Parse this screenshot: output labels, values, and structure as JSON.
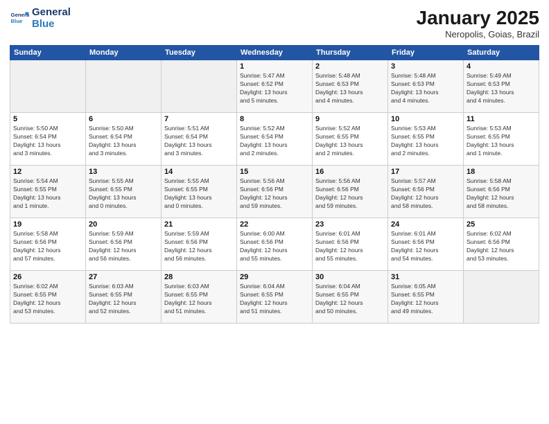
{
  "header": {
    "logo_line1": "General",
    "logo_line2": "Blue",
    "month": "January 2025",
    "location": "Neropolis, Goias, Brazil"
  },
  "weekdays": [
    "Sunday",
    "Monday",
    "Tuesday",
    "Wednesday",
    "Thursday",
    "Friday",
    "Saturday"
  ],
  "weeks": [
    [
      {
        "day": "",
        "info": ""
      },
      {
        "day": "",
        "info": ""
      },
      {
        "day": "",
        "info": ""
      },
      {
        "day": "1",
        "info": "Sunrise: 5:47 AM\nSunset: 6:52 PM\nDaylight: 13 hours\nand 5 minutes."
      },
      {
        "day": "2",
        "info": "Sunrise: 5:48 AM\nSunset: 6:53 PM\nDaylight: 13 hours\nand 4 minutes."
      },
      {
        "day": "3",
        "info": "Sunrise: 5:48 AM\nSunset: 6:53 PM\nDaylight: 13 hours\nand 4 minutes."
      },
      {
        "day": "4",
        "info": "Sunrise: 5:49 AM\nSunset: 6:53 PM\nDaylight: 13 hours\nand 4 minutes."
      }
    ],
    [
      {
        "day": "5",
        "info": "Sunrise: 5:50 AM\nSunset: 6:54 PM\nDaylight: 13 hours\nand 3 minutes."
      },
      {
        "day": "6",
        "info": "Sunrise: 5:50 AM\nSunset: 6:54 PM\nDaylight: 13 hours\nand 3 minutes."
      },
      {
        "day": "7",
        "info": "Sunrise: 5:51 AM\nSunset: 6:54 PM\nDaylight: 13 hours\nand 3 minutes."
      },
      {
        "day": "8",
        "info": "Sunrise: 5:52 AM\nSunset: 6:54 PM\nDaylight: 13 hours\nand 2 minutes."
      },
      {
        "day": "9",
        "info": "Sunrise: 5:52 AM\nSunset: 6:55 PM\nDaylight: 13 hours\nand 2 minutes."
      },
      {
        "day": "10",
        "info": "Sunrise: 5:53 AM\nSunset: 6:55 PM\nDaylight: 13 hours\nand 2 minutes."
      },
      {
        "day": "11",
        "info": "Sunrise: 5:53 AM\nSunset: 6:55 PM\nDaylight: 13 hours\nand 1 minute."
      }
    ],
    [
      {
        "day": "12",
        "info": "Sunrise: 5:54 AM\nSunset: 6:55 PM\nDaylight: 13 hours\nand 1 minute."
      },
      {
        "day": "13",
        "info": "Sunrise: 5:55 AM\nSunset: 6:55 PM\nDaylight: 13 hours\nand 0 minutes."
      },
      {
        "day": "14",
        "info": "Sunrise: 5:55 AM\nSunset: 6:55 PM\nDaylight: 13 hours\nand 0 minutes."
      },
      {
        "day": "15",
        "info": "Sunrise: 5:56 AM\nSunset: 6:56 PM\nDaylight: 12 hours\nand 59 minutes."
      },
      {
        "day": "16",
        "info": "Sunrise: 5:56 AM\nSunset: 6:56 PM\nDaylight: 12 hours\nand 59 minutes."
      },
      {
        "day": "17",
        "info": "Sunrise: 5:57 AM\nSunset: 6:56 PM\nDaylight: 12 hours\nand 58 minutes."
      },
      {
        "day": "18",
        "info": "Sunrise: 5:58 AM\nSunset: 6:56 PM\nDaylight: 12 hours\nand 58 minutes."
      }
    ],
    [
      {
        "day": "19",
        "info": "Sunrise: 5:58 AM\nSunset: 6:56 PM\nDaylight: 12 hours\nand 57 minutes."
      },
      {
        "day": "20",
        "info": "Sunrise: 5:59 AM\nSunset: 6:56 PM\nDaylight: 12 hours\nand 56 minutes."
      },
      {
        "day": "21",
        "info": "Sunrise: 5:59 AM\nSunset: 6:56 PM\nDaylight: 12 hours\nand 56 minutes."
      },
      {
        "day": "22",
        "info": "Sunrise: 6:00 AM\nSunset: 6:56 PM\nDaylight: 12 hours\nand 55 minutes."
      },
      {
        "day": "23",
        "info": "Sunrise: 6:01 AM\nSunset: 6:56 PM\nDaylight: 12 hours\nand 55 minutes."
      },
      {
        "day": "24",
        "info": "Sunrise: 6:01 AM\nSunset: 6:56 PM\nDaylight: 12 hours\nand 54 minutes."
      },
      {
        "day": "25",
        "info": "Sunrise: 6:02 AM\nSunset: 6:56 PM\nDaylight: 12 hours\nand 53 minutes."
      }
    ],
    [
      {
        "day": "26",
        "info": "Sunrise: 6:02 AM\nSunset: 6:55 PM\nDaylight: 12 hours\nand 53 minutes."
      },
      {
        "day": "27",
        "info": "Sunrise: 6:03 AM\nSunset: 6:55 PM\nDaylight: 12 hours\nand 52 minutes."
      },
      {
        "day": "28",
        "info": "Sunrise: 6:03 AM\nSunset: 6:55 PM\nDaylight: 12 hours\nand 51 minutes."
      },
      {
        "day": "29",
        "info": "Sunrise: 6:04 AM\nSunset: 6:55 PM\nDaylight: 12 hours\nand 51 minutes."
      },
      {
        "day": "30",
        "info": "Sunrise: 6:04 AM\nSunset: 6:55 PM\nDaylight: 12 hours\nand 50 minutes."
      },
      {
        "day": "31",
        "info": "Sunrise: 6:05 AM\nSunset: 6:55 PM\nDaylight: 12 hours\nand 49 minutes."
      },
      {
        "day": "",
        "info": ""
      }
    ]
  ]
}
